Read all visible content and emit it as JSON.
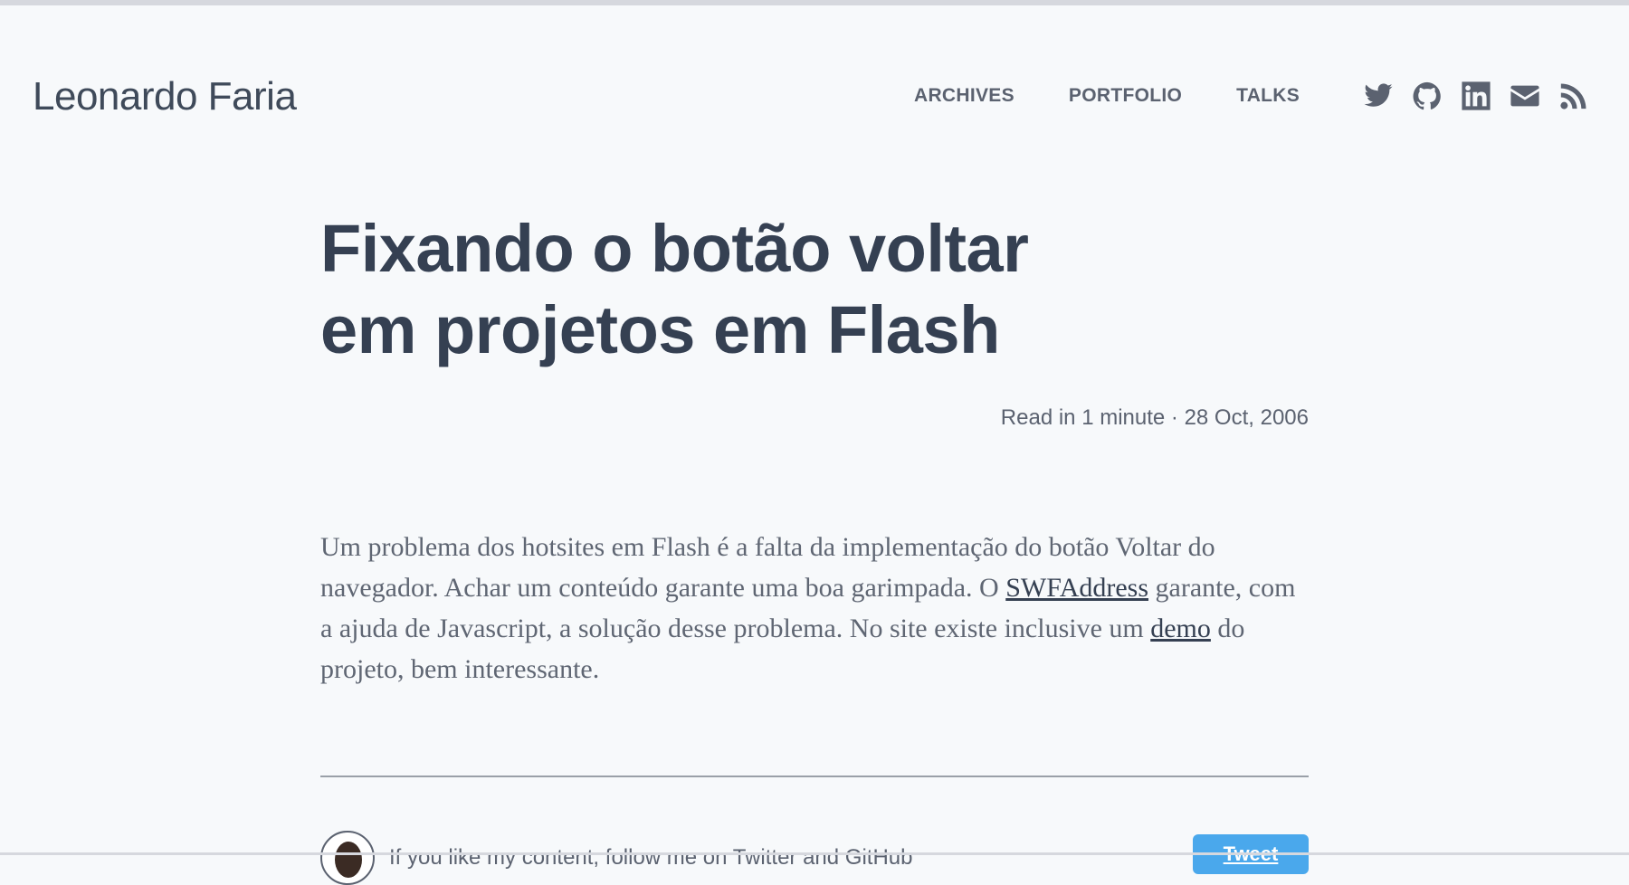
{
  "header": {
    "site_title": "Leonardo Faria",
    "nav": [
      {
        "label": "ARCHIVES"
      },
      {
        "label": "PORTFOLIO"
      },
      {
        "label": "TALKS"
      }
    ],
    "social_icons": [
      "twitter-icon",
      "github-icon",
      "linkedin-icon",
      "email-icon",
      "rss-icon"
    ]
  },
  "post": {
    "title": "Fixando o botão voltar em projetos em Flash",
    "meta": "Read in 1 minute · 28 Oct, 2006",
    "body": {
      "p1_a": "Um problema dos hotsites em Flash é a falta da implementação do botão Voltar do navegador. Achar um conteúdo garante uma boa garimpada. O ",
      "link1": "SWFAddress",
      "p1_b": " garante, com a ajuda de Javascript, a solução desse problema. No site existe inclusive um ",
      "link2": "demo",
      "p1_c": " do projeto, bem interessante."
    }
  },
  "footer": {
    "author_text": "If you like my content, follow me on Twitter and GitHub",
    "tweet_label": "Tweet"
  },
  "colors": {
    "background": "#f7f9fb",
    "title": "#354052",
    "nav": "#5b6270",
    "tweet_button": "#4aa8ec"
  }
}
